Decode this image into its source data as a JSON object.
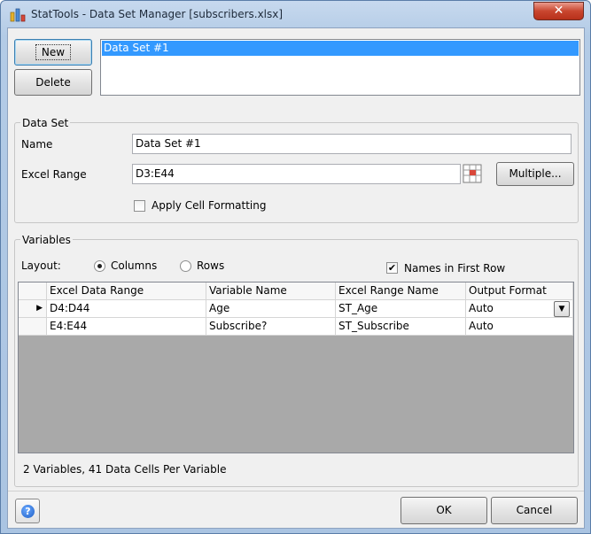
{
  "window": {
    "title": "StatTools - Data Set Manager [subscribers.xlsx]",
    "close_glyph": "✕",
    "app_icon": "stattools-icon"
  },
  "top": {
    "new_label": "New",
    "delete_label": "Delete",
    "datasets": [
      "Data Set #1"
    ]
  },
  "dataset": {
    "group_label": "Data Set",
    "name_label": "Name",
    "name_value": "Data Set #1",
    "range_label": "Excel Range",
    "range_value": "D3:E44",
    "multiple_label": "Multiple...",
    "apply_formatting_label": "Apply Cell Formatting",
    "apply_formatting_checked": false
  },
  "variables": {
    "group_label": "Variables",
    "layout_label": "Layout:",
    "columns_label": "Columns",
    "rows_label": "Rows",
    "layout_selected": "Columns",
    "names_first_row_label": "Names in First Row",
    "names_first_row_checked": true,
    "columns": [
      "Excel Data Range",
      "Variable Name",
      "Excel Range Name",
      "Output Format"
    ],
    "rows": [
      [
        "D4:D44",
        "Age",
        "ST_Age",
        "Auto"
      ],
      [
        "E4:E44",
        "Subscribe?",
        "ST_Subscribe",
        "Auto"
      ]
    ],
    "current_row_marker": "▶",
    "status": "2 Variables, 41 Data Cells Per Variable"
  },
  "footer": {
    "ok_label": "OK",
    "cancel_label": "Cancel",
    "help_glyph": "?"
  }
}
